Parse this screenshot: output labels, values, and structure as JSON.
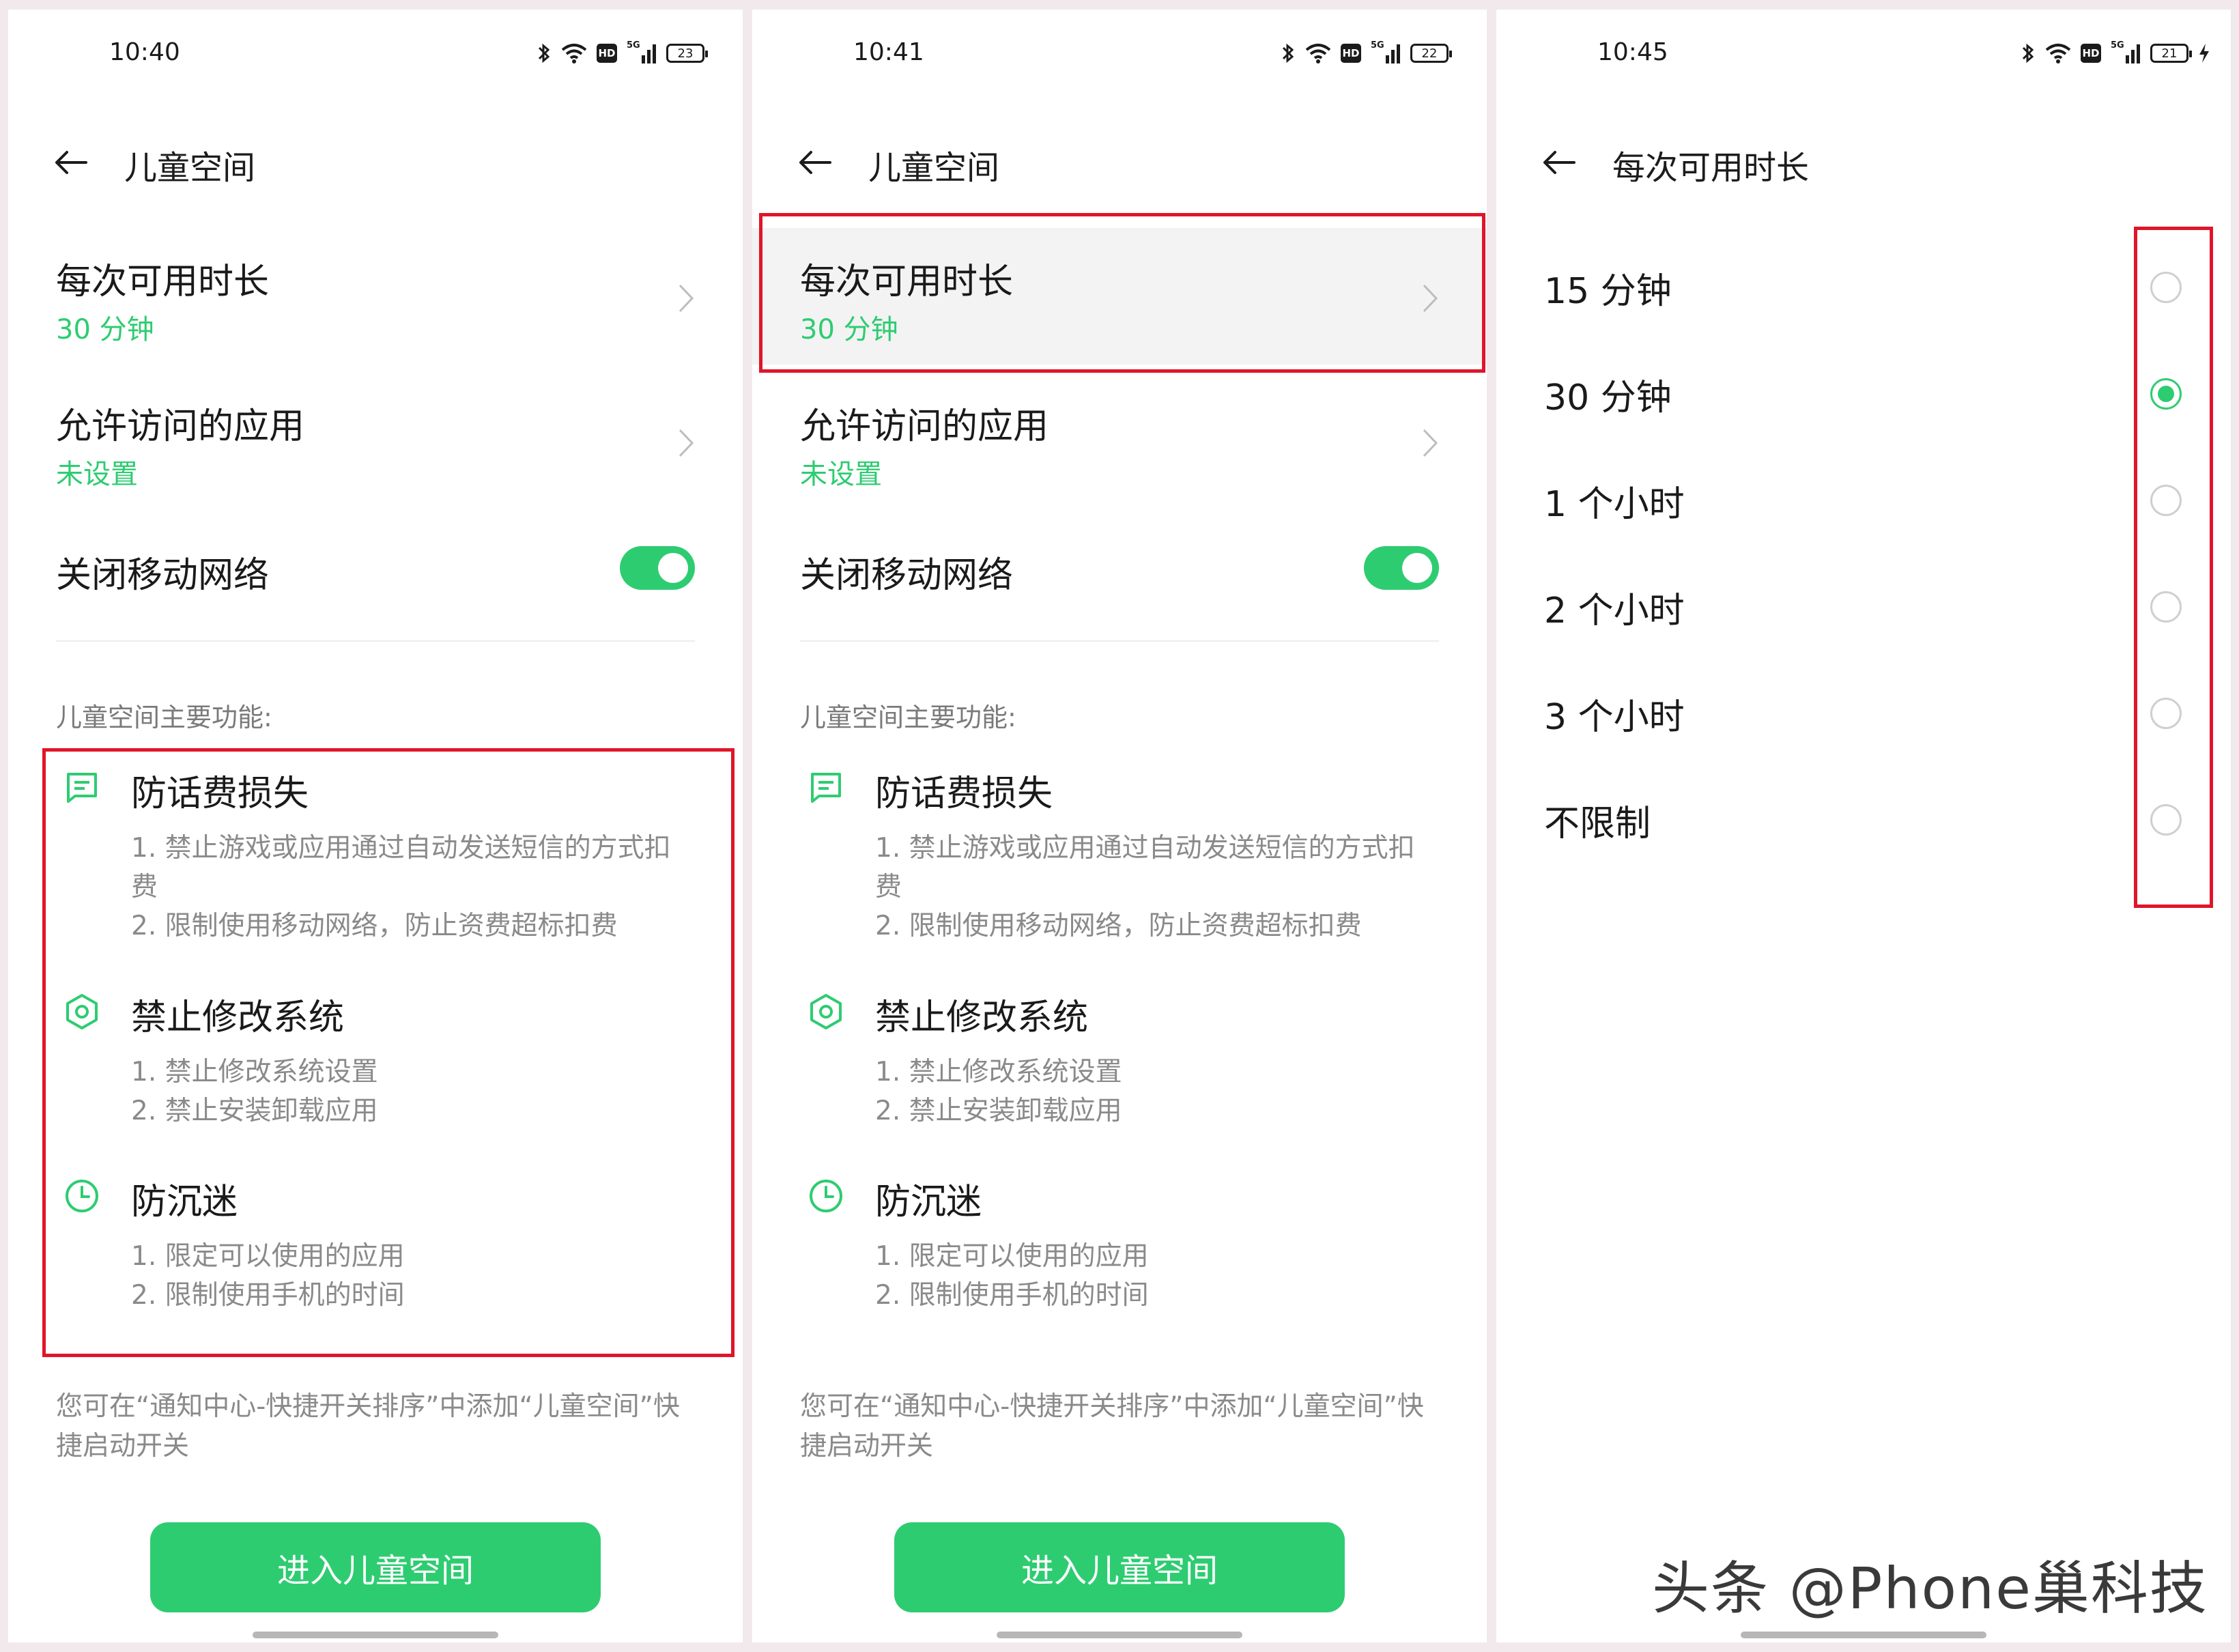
{
  "colors": {
    "accent": "#2ecc71",
    "highlight": "#e0152a",
    "muted": "#8a8a8a"
  },
  "screens": [
    {
      "status": {
        "time": "10:40",
        "battery": "23"
      },
      "title": "儿童空间",
      "duration": {
        "title": "每次可用时长",
        "value": "30 分钟"
      },
      "apps": {
        "title": "允许访问的应用",
        "value": "未设置"
      },
      "network": {
        "title": "关闭移动网络",
        "on": true
      },
      "features_title": "儿童空间主要功能:",
      "features": [
        {
          "icon": "message-icon",
          "title": "防话费损失",
          "desc": [
            "1. 禁止游戏或应用通过自动发送短信的方式扣费",
            "2. 限制使用移动网络，防止资费超标扣费"
          ]
        },
        {
          "icon": "hexagon-settings-icon",
          "title": "禁止修改系统",
          "desc": [
            "1. 禁止修改系统设置",
            "2. 禁止安装卸载应用"
          ]
        },
        {
          "icon": "clock-icon",
          "title": "防沉迷",
          "desc": [
            "1. 限定可以使用的应用",
            "2. 限制使用手机的时间"
          ]
        }
      ],
      "note": "您可在“通知中心-快捷开关排序”中添加“儿童空间”快捷启动开关",
      "button": "进入儿童空间"
    },
    {
      "status": {
        "time": "10:41",
        "battery": "22"
      },
      "title": "儿童空间",
      "duration": {
        "title": "每次可用时长",
        "value": "30 分钟"
      },
      "apps": {
        "title": "允许访问的应用",
        "value": "未设置"
      },
      "network": {
        "title": "关闭移动网络",
        "on": true
      },
      "features_title": "儿童空间主要功能:",
      "features": [
        {
          "icon": "message-icon",
          "title": "防话费损失",
          "desc": [
            "1. 禁止游戏或应用通过自动发送短信的方式扣费",
            "2. 限制使用移动网络，防止资费超标扣费"
          ]
        },
        {
          "icon": "hexagon-settings-icon",
          "title": "禁止修改系统",
          "desc": [
            "1. 禁止修改系统设置",
            "2. 禁止安装卸载应用"
          ]
        },
        {
          "icon": "clock-icon",
          "title": "防沉迷",
          "desc": [
            "1. 限定可以使用的应用",
            "2. 限制使用手机的时间"
          ]
        }
      ],
      "note": "您可在“通知中心-快捷开关排序”中添加“儿童空间”快捷启动开关",
      "button": "进入儿童空间"
    },
    {
      "status": {
        "time": "10:45",
        "battery": "21",
        "charging": true
      },
      "title": "每次可用时长",
      "options": [
        {
          "label": "15 分钟",
          "selected": false
        },
        {
          "label": "30 分钟",
          "selected": true
        },
        {
          "label": "1 个小时",
          "selected": false
        },
        {
          "label": "2 个小时",
          "selected": false
        },
        {
          "label": "3 个小时",
          "selected": false
        },
        {
          "label": "不限制",
          "selected": false
        }
      ]
    }
  ],
  "watermark": "头条 @Phone巢科技"
}
